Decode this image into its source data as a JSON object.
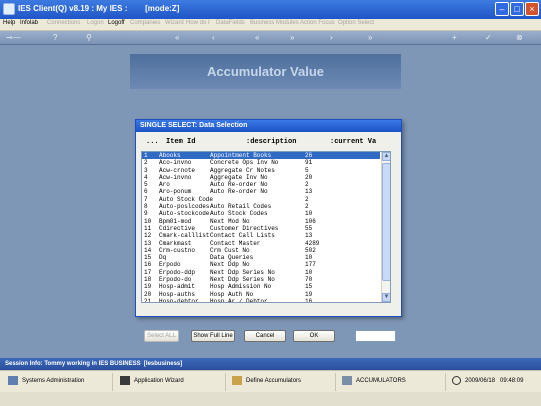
{
  "window": {
    "title": "IES Client(Q) v8.19 : My IES :        [mode:Z]"
  },
  "menu": [
    {
      "label": "Help",
      "dim": false
    },
    {
      "label": "Infolab",
      "dim": false
    },
    {
      "label": "Connections",
      "dim": true
    },
    {
      "label": "Logon",
      "dim": true
    },
    {
      "label": "Logoff",
      "dim": false
    },
    {
      "label": "Companies",
      "dim": true
    },
    {
      "label": "Wizard",
      "dim": true
    },
    {
      "label": "How do I",
      "dim": true
    },
    {
      "label": "DataFields",
      "dim": true
    },
    {
      "label": "Business Modules",
      "dim": true
    },
    {
      "label": "Action Focus",
      "dim": true
    },
    {
      "label": "Option Select",
      "dim": true
    }
  ],
  "banner": {
    "title": "Accumulator Value"
  },
  "dialog": {
    "title": "SINGLE SELECT: Data Selection",
    "header": {
      "dots": "...",
      "item_id": "Item Id",
      "description": ":description",
      "current": ":current Va"
    },
    "rows": [
      [
        "1",
        "Abooks",
        "Appointment Books",
        "26"
      ],
      [
        "2",
        "Aco-invno",
        "Concrete Ops Inv No",
        "91"
      ],
      [
        "3",
        "Acw-crnote",
        "Aggregate Cr Notes",
        "5"
      ],
      [
        "4",
        "Acw-invno",
        "Aggregate Inv No",
        "20"
      ],
      [
        "5",
        "Aro",
        "Auto Re-order No",
        "2"
      ],
      [
        "6",
        "Aro-ponum",
        "Auto Re-order No",
        "13"
      ],
      [
        "7",
        "Auto Stock Code",
        "",
        "2"
      ],
      [
        "8",
        "Auto-poslcodes",
        "Auto Retail Codes",
        "2"
      ],
      [
        "9",
        "Auto-stockcode",
        "Auto Stock Codes",
        "10"
      ],
      [
        "10",
        "Bpm01-mod",
        "Next Mod No",
        "106"
      ],
      [
        "11",
        "Cdirective",
        "Customer Directives",
        "55"
      ],
      [
        "12",
        "Cmark-calllist",
        "Contact Call Lists",
        "13"
      ],
      [
        "13",
        "Cmarkmast",
        "Contact Master",
        "4289"
      ],
      [
        "14",
        "Crm-custno",
        "Crm Cust No",
        "502"
      ],
      [
        "15",
        "Dq",
        "Data Queries",
        "10"
      ],
      [
        "16",
        "Erpodo",
        "Next Ddp No",
        "177"
      ],
      [
        "17",
        "Erpodo-ddp",
        "Next Ddp Series No",
        "10"
      ],
      [
        "18",
        "Erpodo-do",
        "Next Ddp Series No",
        "70"
      ],
      [
        "19",
        "Hosp-admit",
        "Hosp Admission No",
        "15"
      ],
      [
        "20",
        "Hosp-auths",
        "Hosp Auth No",
        "19"
      ],
      [
        "21",
        "Hosp-debtor",
        "Hosp Ar / Debtor",
        "16"
      ]
    ],
    "selected_index": 0,
    "buttons": {
      "select_all": "Select ALL",
      "show_full_line": "Show Full Line",
      "cancel": "Cancel",
      "ok": "OK"
    }
  },
  "session": {
    "text": "Session Info: Tommy working in IES BUSINESS  [Iesbusiness]"
  },
  "status": {
    "items": [
      {
        "label": "Systems Administration",
        "icon": "grid-icon"
      },
      {
        "label": "Application Wizard",
        "icon": "wizard-icon"
      },
      {
        "label": "Define Accumulators",
        "icon": "define-icon"
      },
      {
        "label": "ACCUMULATORS",
        "icon": "accumulators-icon"
      }
    ],
    "date": "2009/06/18",
    "time": "09:48:09"
  },
  "colors": {
    "titlebar": "#1f55c8",
    "selection": "#316ac5",
    "background": "#7f97b6",
    "close": "#d4532e"
  }
}
